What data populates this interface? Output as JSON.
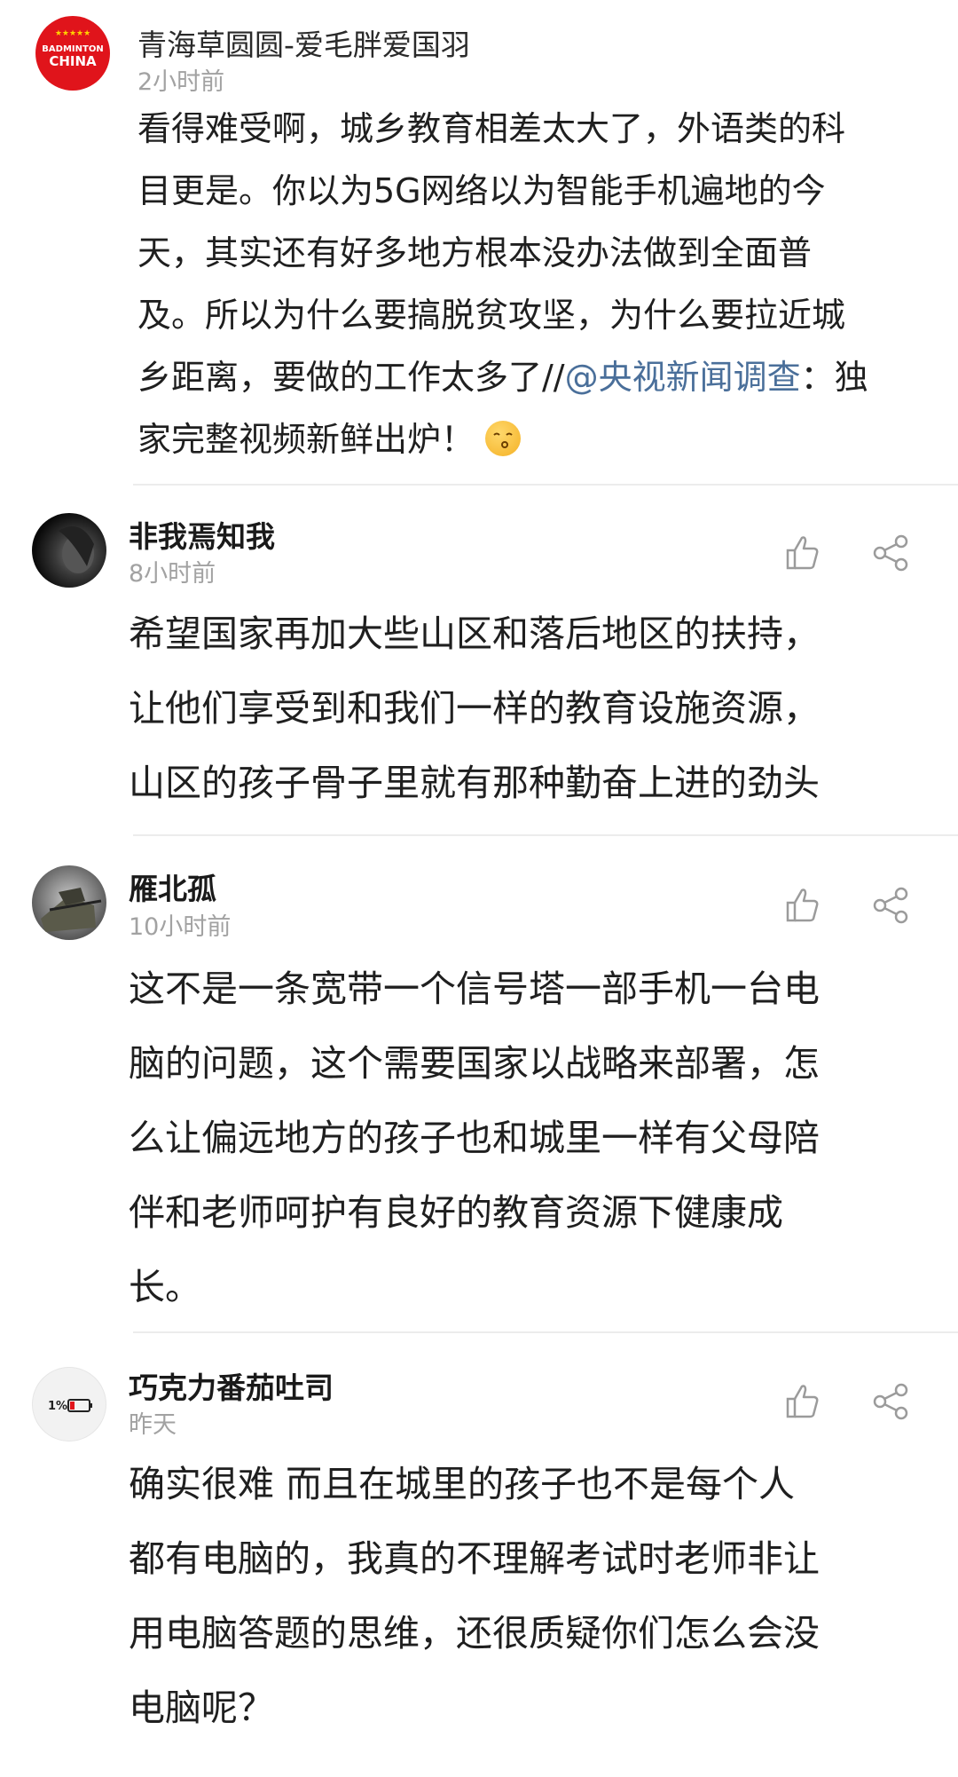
{
  "comments": [
    {
      "author": "青海草圆圆-爱毛胖爱国羽",
      "time": "2小时前",
      "avatar_text_top": "BADMINTON",
      "avatar_text_bottom": "CHINA",
      "lines": [
        "看得难受啊，城乡教育相差太大了，外语类的科",
        "目更是。你以为5G网络以为智能手机遍地的今",
        "天，其实还有好多地方根本没办法做到全面普",
        "及。所以为什么要搞脱贫攻坚，为什么要拉近城",
        "乡距离，要做的工作太多了//"
      ],
      "mention": "@央视新闻调查",
      "after_mention": "：独",
      "last_line": "家完整视频新鲜出炉！"
    },
    {
      "author": "非我焉知我",
      "time": "8小时前",
      "lines": [
        "希望国家再加大些山区和落后地区的扶持，",
        "让他们享受到和我们一样的教育设施资源，",
        "山区的孩子骨子里就有那种勤奋上进的劲头"
      ]
    },
    {
      "author": "雁北孤",
      "time": "10小时前",
      "lines": [
        "这不是一条宽带一个信号塔一部手机一台电",
        "脑的问题，这个需要国家以战略来部署，怎",
        "么让偏远地方的孩子也和城里一样有父母陪",
        "伴和老师呵护有良好的教育资源下健康成",
        "长。"
      ]
    },
    {
      "author": "巧克力番茄吐司",
      "time": "昨天",
      "avatar_text": "1%",
      "lines": [
        "确实很难 而且在城里的孩子也不是每个人",
        "都有电脑的，我真的不理解考试时老师非让",
        "用电脑答题的思维，还很质疑你们怎么会没",
        "电脑呢？"
      ]
    }
  ],
  "icons": {
    "like": "thumbs-up-icon",
    "share": "share-icon",
    "emoji": "kissing-face-emoji"
  },
  "colors": {
    "mention": "#4a6f9a",
    "time": "#a2a2a2",
    "badge_red": "#e0141b"
  }
}
